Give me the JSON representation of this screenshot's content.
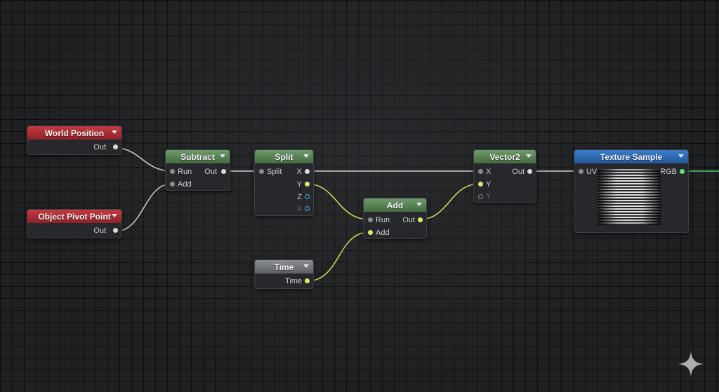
{
  "nodes": {
    "world_position": {
      "title": "World Position",
      "out": "Out"
    },
    "object_pivot": {
      "title": "Object Pivot Point",
      "out": "Out"
    },
    "subtract": {
      "title": "Subtract",
      "in1": "Run",
      "in2": "Add",
      "out": "Out"
    },
    "split": {
      "title": "Split",
      "in": "Split",
      "x": "X",
      "y": "Y",
      "z": "Z",
      "xx": "X"
    },
    "time": {
      "title": "Time",
      "out": "Time"
    },
    "add": {
      "title": "Add",
      "in1": "Run",
      "in2": "Add",
      "out": "Out"
    },
    "vector2": {
      "title": "Vector2",
      "x": "X",
      "y": "Y",
      "y2": "Y",
      "out": "Out"
    },
    "texture_sample": {
      "title": "Texture Sample",
      "in": "UV",
      "out": "RGB"
    }
  },
  "colors": {
    "wire_white": "#cfcfcf",
    "wire_yellow": "#d6d85a",
    "wire_green": "#4fd36a"
  },
  "icons": {
    "corner": "sparkle-icon"
  }
}
